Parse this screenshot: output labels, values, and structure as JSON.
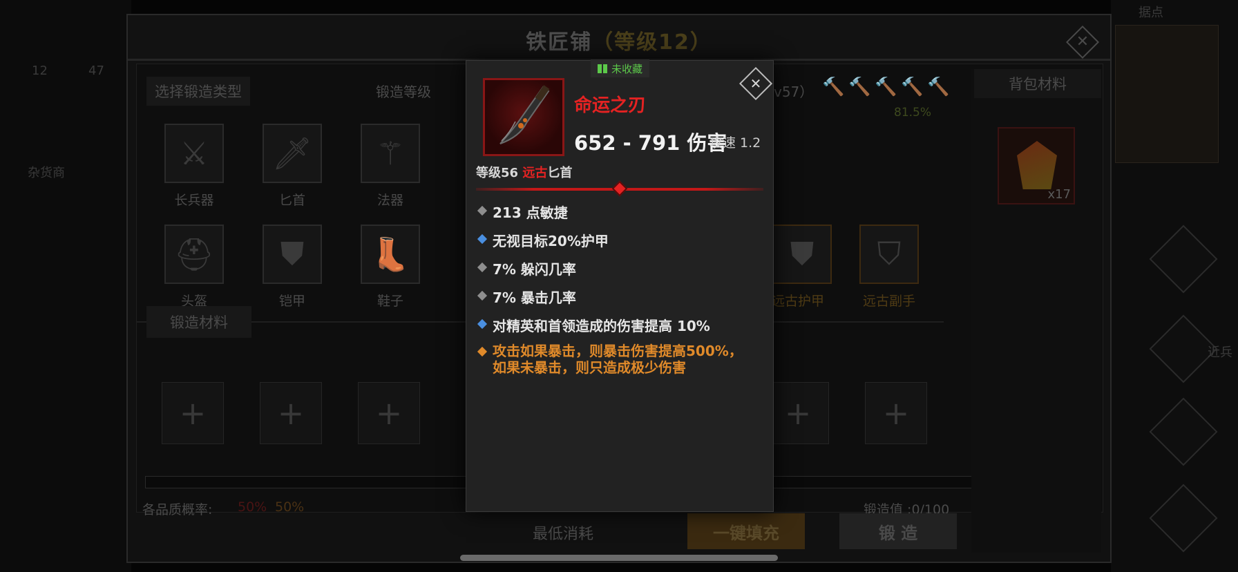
{
  "background": {
    "left_labels": [
      "12",
      "47",
      "杂货商"
    ],
    "right_labels": [
      "据点",
      "近兵"
    ]
  },
  "panel": {
    "title": "铁匠铺",
    "title_level": "（等级12）",
    "close_glyph": "✕",
    "select_type_label": "选择锻造类型",
    "forge_level_label": "锻造等级",
    "level_partial": "v57）",
    "success_rate": "81.5%",
    "bag_label": "背包材料",
    "bag_item_count": "x17",
    "types_row1": [
      {
        "label": "长兵器",
        "icon": "axe-icon",
        "glyph": "⚔"
      },
      {
        "label": "匕首",
        "icon": "dagger-icon",
        "glyph": "🗡"
      },
      {
        "label": "法器",
        "icon": "staff-icon",
        "glyph": "⚚"
      }
    ],
    "types_row2": [
      {
        "label": "头盔",
        "icon": "helmet-icon",
        "glyph": "⛑"
      },
      {
        "label": "铠甲",
        "icon": "armor-icon",
        "glyph": "⛊"
      },
      {
        "label": "鞋子",
        "icon": "boot-icon",
        "glyph": "👢"
      }
    ],
    "ancient_types": [
      {
        "label": "远古护甲",
        "icon": "ancient-armor-icon",
        "glyph": "⛊"
      },
      {
        "label": "远古副手",
        "icon": "ancient-offhand-icon",
        "glyph": "⛉"
      }
    ],
    "materials_label": "锻造材料",
    "material_slot_glyph": "+",
    "quality_label": "各品质概率:",
    "quality_values": [
      "50%",
      "50%"
    ],
    "forge_value": "锻造值 :0/100",
    "min_cost_label": "最低消耗",
    "fill_button": "一键填充",
    "forge_button": "锻 造"
  },
  "tooltip": {
    "badge": "未收藏",
    "close_glyph": "✕",
    "name": "命运之刃",
    "damage": "652 - 791 伤害",
    "speed": "攻速 1.2",
    "level_prefix": "等级56",
    "rarity": "远古",
    "item_type": "匕首",
    "affixes": [
      {
        "text": "213 点敏捷",
        "kind": "grey"
      },
      {
        "text": "无视目标20%护甲",
        "kind": "blue"
      },
      {
        "text": "7% 躲闪几率",
        "kind": "grey"
      },
      {
        "text": "7% 暴击几率",
        "kind": "grey"
      },
      {
        "text": "对精英和首领造成的伤害提高 10%",
        "kind": "blue"
      }
    ],
    "legendary_affix_line1": "攻击如果暴击，则暴击伤害提高500%，",
    "legendary_affix_line2": "如果未暴击，则只造成极少伤害"
  },
  "colors": {
    "legendary_red": "#e52222",
    "ancient_orange": "#e08a2a",
    "magic_blue": "#4a8fe0",
    "collected_green": "#5cc94a"
  }
}
